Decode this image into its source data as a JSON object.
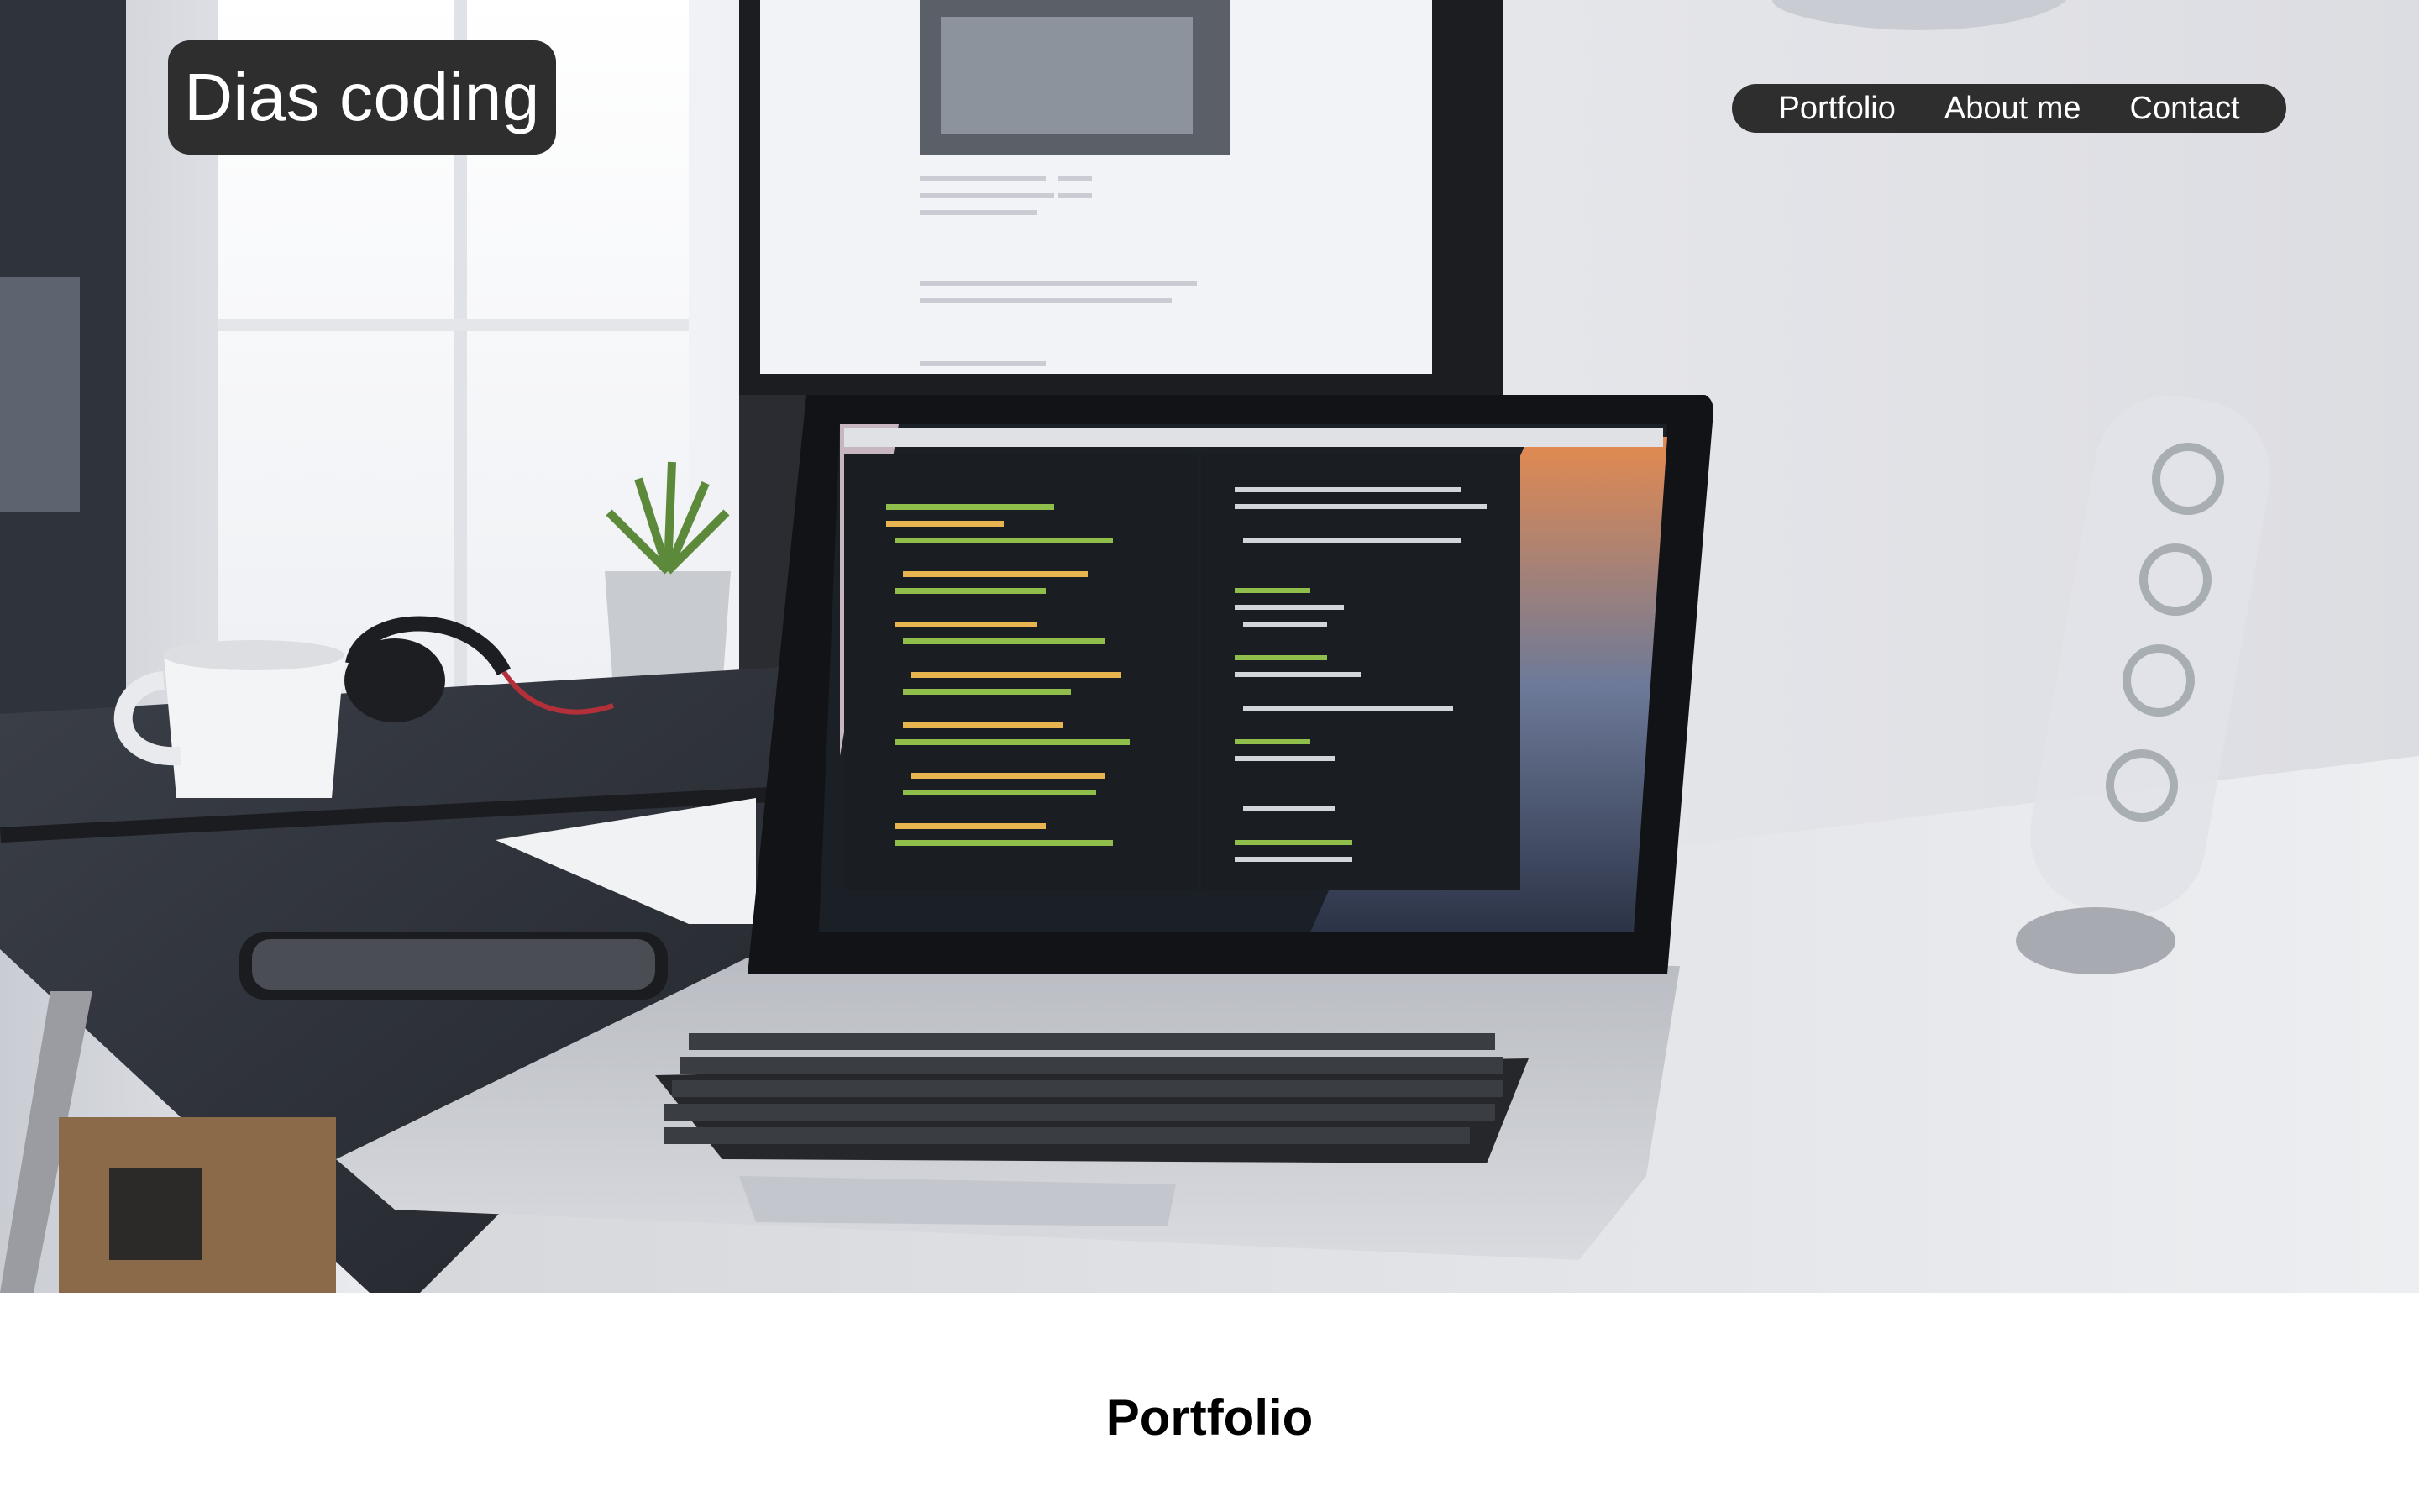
{
  "brand": {
    "label": "Dias coding"
  },
  "nav": {
    "items": [
      {
        "label": "Portfolio"
      },
      {
        "label": "About me"
      },
      {
        "label": "Contact"
      }
    ]
  },
  "hero": {
    "image": "photo of a laptop showing a code editor on a desk"
  },
  "section": {
    "title": "Portfolio"
  },
  "colors": {
    "badge_bg": "#2e2e2e",
    "badge_text": "#ffffff",
    "page_bg": "#ffffff",
    "heading_text": "#000000"
  }
}
